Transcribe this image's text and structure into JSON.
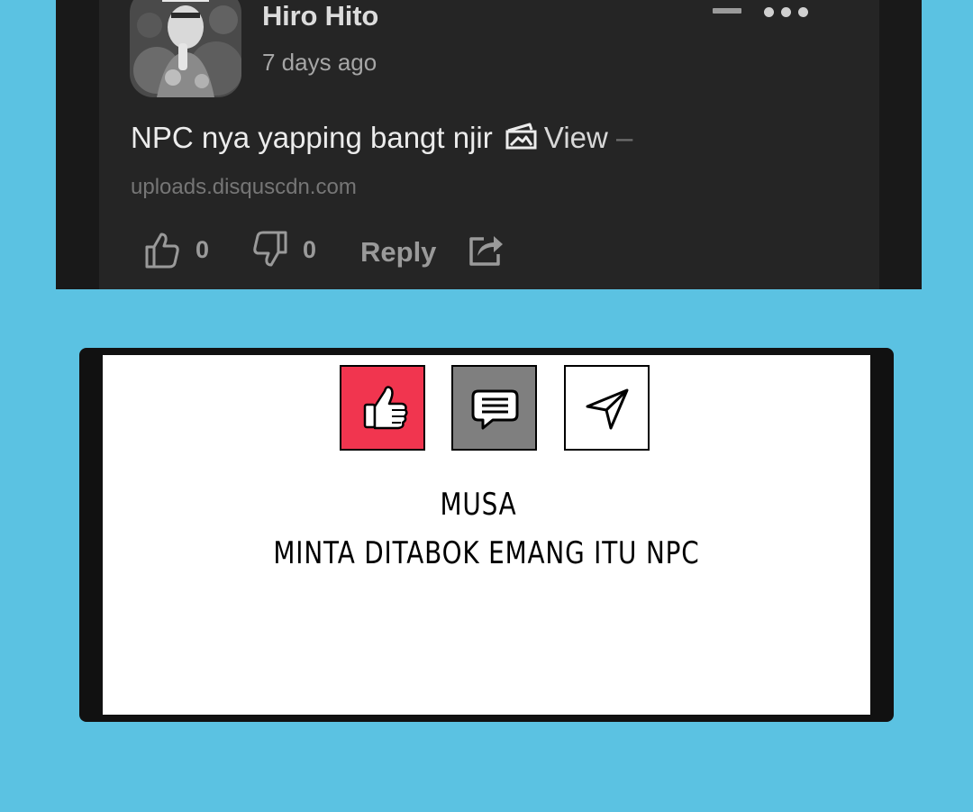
{
  "comment": {
    "author": "Hiro Hito",
    "timestamp": "7 days ago",
    "message": "NPC nya yapping bangt njir",
    "view_label": "View",
    "view_suffix": "–",
    "source_link": "uploads.disquscdn.com",
    "upvotes": "0",
    "downvotes": "0",
    "reply_label": "Reply",
    "icons": {
      "collapse": "minus-icon",
      "more": "more-horizontal-icon",
      "image": "image-icon",
      "upvote": "thumbs-up-outline-icon",
      "downvote": "thumbs-down-outline-icon",
      "share": "share-icon"
    },
    "colors": {
      "card_bg": "#252525",
      "card_border": "#191919",
      "author_text": "#dcdcdc",
      "muted_text": "#a6a6a6"
    }
  },
  "panel": {
    "name": "MUSA",
    "speech": "MINTA DITABOK EMANG ITU NPC",
    "icons": {
      "like": "thumbs-up-icon",
      "comment": "chat-bubble-icon",
      "share": "paper-plane-icon"
    },
    "colors": {
      "like": "#f1354f",
      "comment": "#7f7f7f",
      "share": "#ffffff",
      "background": "#5bc2e2"
    }
  }
}
